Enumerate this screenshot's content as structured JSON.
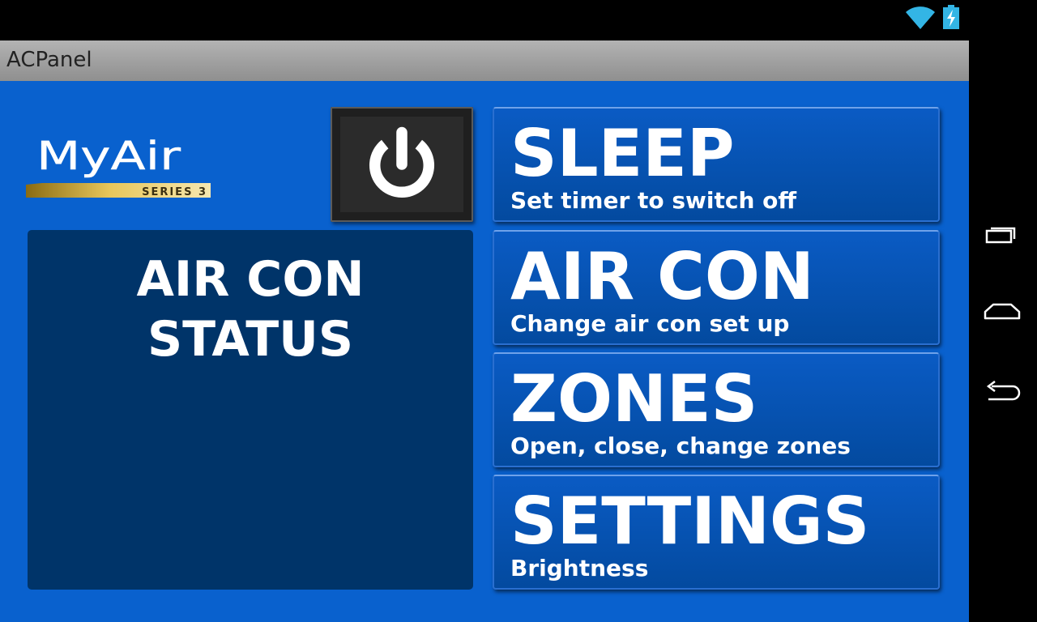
{
  "status_bar": {
    "wifi_icon": "wifi-icon",
    "battery_icon": "battery-charging-icon"
  },
  "app": {
    "title": "ACPanel"
  },
  "logo": {
    "brand": "MyAir",
    "series": "SERIES 3"
  },
  "power_button": {
    "icon": "power-icon"
  },
  "status_panel": {
    "title": "AIR CON STATUS"
  },
  "menu": [
    {
      "title": "SLEEP",
      "subtitle": "Set timer to switch off"
    },
    {
      "title": "AIR CON",
      "subtitle": "Change air con set up"
    },
    {
      "title": "ZONES",
      "subtitle": "Open, close, change zones"
    },
    {
      "title": "SETTINGS",
      "subtitle": "Brightness"
    }
  ],
  "nav_bar": {
    "recents_icon": "recent-apps-icon",
    "home_icon": "home-icon",
    "back_icon": "back-icon"
  },
  "colors": {
    "background": "#0961ce",
    "status_panel": "#003469",
    "menu_button": "#0a5bc4",
    "title_bar": "#a0a0a0",
    "icon_accent": "#33b5e5",
    "logo_gold": "#c9a227"
  }
}
